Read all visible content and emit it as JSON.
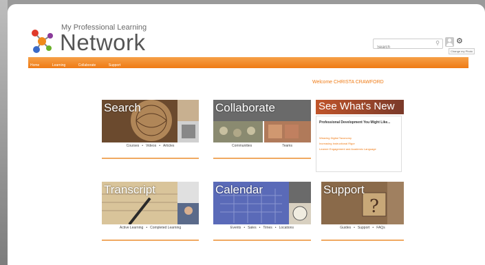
{
  "header": {
    "logo_subtitle": "My Professional Learning",
    "logo_title": "Network",
    "search_placeholder": "Search",
    "tooltip": "Change my Photo"
  },
  "nav": {
    "items": [
      "Home",
      "Learning",
      "Collaborate",
      "Support"
    ]
  },
  "welcome": "Welcome CHRISTA CRAWFORD",
  "tiles": {
    "search": {
      "title": "Search",
      "links": [
        "Courses",
        "Videos",
        "Articles"
      ]
    },
    "collaborate": {
      "title": "Collaborate",
      "links": [
        "Communities",
        "Teams"
      ]
    },
    "seenew": {
      "title": "See What's New"
    },
    "transcript": {
      "title": "Transcript",
      "links": [
        "Active Learning",
        "Completed Learning"
      ]
    },
    "calendar": {
      "title": "Calendar",
      "links": [
        "Events",
        "Sales",
        "Times",
        "Locations"
      ]
    },
    "support": {
      "title": "Support",
      "links": [
        "Guides",
        "Support",
        "FAQs"
      ]
    }
  },
  "whats_new": {
    "heading": "Professional Development You Might Like...",
    "items": [
      "Weaving Digital Taxonomy",
      "Increasing Instructional Rigor",
      "Learner Engagement and Academic Language"
    ]
  },
  "colors": {
    "accent": "#ef7a14",
    "nav_bar": "#f28a28"
  }
}
